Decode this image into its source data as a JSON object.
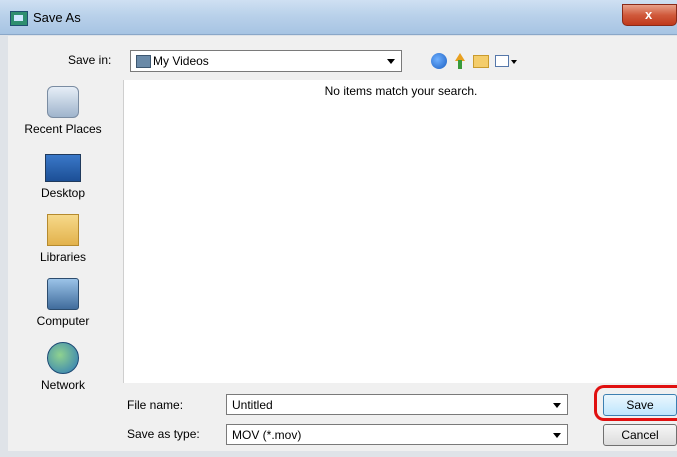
{
  "window": {
    "title": "Save As",
    "close_label": "x"
  },
  "toolbar": {
    "save_in_label": "Save in:",
    "location": "My Videos"
  },
  "places": [
    {
      "label": "Recent Places"
    },
    {
      "label": "Desktop"
    },
    {
      "label": "Libraries"
    },
    {
      "label": "Computer"
    },
    {
      "label": "Network"
    }
  ],
  "file_list": {
    "empty_message": "No items match your search."
  },
  "form": {
    "file_name_label": "File name:",
    "file_name_value": "Untitled",
    "save_type_label": "Save as type:",
    "save_type_value": "MOV (*.mov)"
  },
  "buttons": {
    "save": "Save",
    "cancel": "Cancel"
  },
  "colors": {
    "highlight": "#e01010",
    "title_bar": "#b9d1ea",
    "close_button": "#c0391b"
  }
}
